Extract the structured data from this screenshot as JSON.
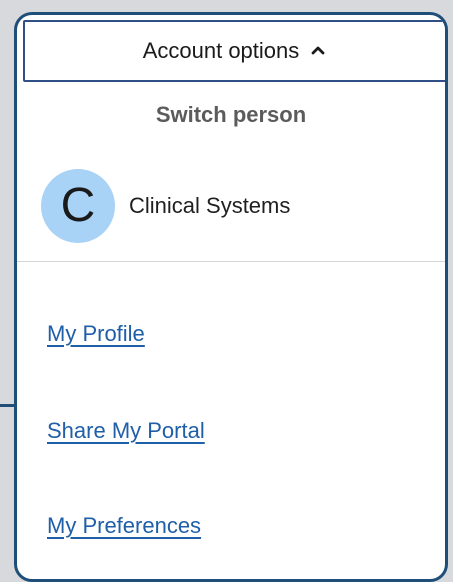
{
  "menu": {
    "button_label": "Account options",
    "switch_person_label": "Switch person",
    "person": {
      "avatar_initial": "C",
      "name": "Clinical Systems"
    },
    "links": [
      {
        "label": "My Profile"
      },
      {
        "label": "Share My Portal"
      },
      {
        "label": "My Preferences"
      }
    ]
  },
  "colors": {
    "border": "#1f4f79",
    "button_border": "#2f4f86",
    "avatar_bg": "#a8d2f6",
    "link": "#1f5fa8",
    "title": "#5b5b5b"
  },
  "icons": {
    "button": "chevron-up-icon"
  }
}
